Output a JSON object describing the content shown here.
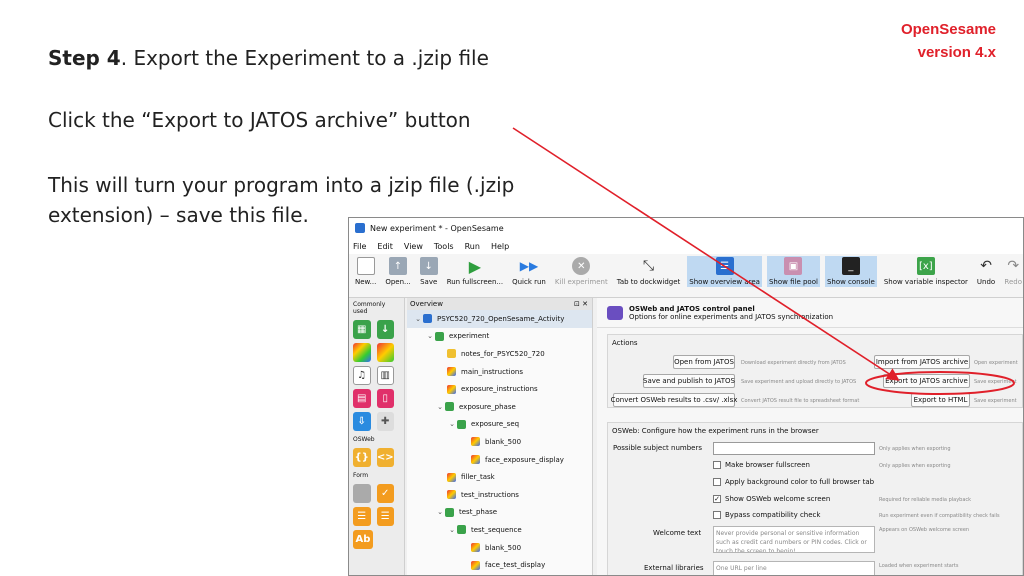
{
  "brand": {
    "line1": "OpenSesame",
    "line2": "version 4.x"
  },
  "slide": {
    "step_bold": "Step 4",
    "step_rest": ". Export the Experiment to a .jzip file",
    "instruction": "Click the “Export to JATOS archive” button",
    "note": "This will turn your program into a jzip file (.jzip extension) – save this file."
  },
  "window": {
    "title": "New experiment * - OpenSesame",
    "menu": [
      "File",
      "Edit",
      "View",
      "Tools",
      "Run",
      "Help"
    ],
    "toolbar": [
      "New...",
      "Open...",
      "Save",
      "Run fullscreen...",
      "Quick run",
      "Kill experiment",
      "Tab to dockwidget",
      "Show overview area",
      "Show file pool",
      "Show console",
      "Show variable inspector",
      "Undo",
      "Redo"
    ]
  },
  "palette": {
    "commonly_used": "Commonly used",
    "osweb": "OSWeb",
    "form": "Form"
  },
  "overview": {
    "title": "Overview",
    "items": [
      "PSYC520_720_OpenSesame_Activity",
      "experiment",
      "notes_for_PSYC520_720",
      "main_instructions",
      "exposure_instructions",
      "exposure_phase",
      "exposure_seq",
      "blank_500",
      "face_exposure_display",
      "filler_task",
      "test_instructions",
      "test_phase",
      "test_sequence",
      "blank_500",
      "face_test_display"
    ]
  },
  "panel": {
    "title": "OSWeb and JATOS control panel",
    "subtitle": "Options for online experiments and JATOS synchronization",
    "actions_label": "Actions",
    "open_jatos": "Open from JATOS",
    "open_jatos_hint": "Download experiment directly from JATOS",
    "save_publish": "Save and publish to JATOS",
    "save_publish_hint": "Save experiment and upload directly to JATOS",
    "convert": "Convert OSWeb results to .csv/ .xlsx",
    "convert_hint": "Convert JATOS result file to spreadsheet format",
    "import_jatos": "Import from JATOS archive",
    "import_hint": "Open experiment",
    "export_jatos": "Export to JATOS archive",
    "export_hint": "Save experiment",
    "export_html": "Export to HTML",
    "export_html_hint": "Save experiment",
    "osweb_label": "OSWeb: Configure how the experiment runs in the browser",
    "subject_numbers": "Possible subject numbers",
    "subject_hint": "Only applies when exporting",
    "fullscreen": "Make browser fullscreen",
    "fullscreen_hint": "Only applies when exporting",
    "bg_color": "Apply background color to full browser tab",
    "welcome_screen": "Show OSWeb welcome screen",
    "welcome_screen_hint": "Required for reliable media playback",
    "bypass": "Bypass compatibility check",
    "bypass_hint": "Run experiment even if compatibility check fails",
    "welcome_text_label": "Welcome text",
    "welcome_text": "Never provide personal or sensitive information such as credit card numbers or PIN codes. Click or touch the screen to begin!",
    "welcome_text_hint": "Appears on OSWeb welcome screen",
    "external_label": "External libraries",
    "external_placeholder": "One URL per line",
    "external_hint": "Loaded when experiment starts"
  },
  "colors": {
    "brand_red": "#e0202a",
    "selection_blue": "#bfd9f2"
  }
}
